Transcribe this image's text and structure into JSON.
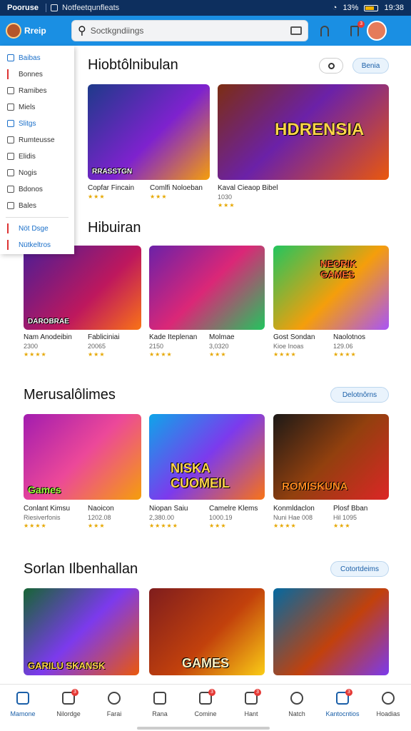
{
  "status": {
    "brand": "Pooruse",
    "notif": "Notfeetqunfleats",
    "battery": "13%",
    "time": "19:38"
  },
  "appbar": {
    "app_name": "Rreip",
    "search_placeholder": "Soctkgndiings"
  },
  "sidebar": {
    "items": [
      {
        "label": "Baibas",
        "style": "blue"
      },
      {
        "label": "Bonnes",
        "style": "mark"
      },
      {
        "label": "Ramibes",
        "style": ""
      },
      {
        "label": "Miels",
        "style": ""
      },
      {
        "label": "Slitgs",
        "style": "blue"
      },
      {
        "label": "Rumteusse",
        "style": ""
      },
      {
        "label": "Elidis",
        "style": ""
      },
      {
        "label": "Nogis",
        "style": ""
      },
      {
        "label": "Bdonos",
        "style": ""
      },
      {
        "label": "Bales",
        "style": ""
      },
      {
        "label": "Nöt Dsge",
        "style": "bluemark"
      },
      {
        "label": "Nütkeltros",
        "style": "bluemark"
      }
    ]
  },
  "sections": [
    {
      "title": "Hiobtôlnibulan",
      "pill": "Benia",
      "cards": [
        {
          "image_text": "RRASSTGN",
          "title": "Copfar Fincain",
          "sub": "",
          "stars": "★★★"
        },
        {
          "image_text": "",
          "title": "Comlfi Noloeban",
          "sub": "",
          "stars": "★★★"
        },
        {
          "image_text": "HDRENSIA",
          "title": "Kaval Cieaop Bibel",
          "sub": "1030",
          "stars": "★★★"
        }
      ]
    },
    {
      "title": "Hibuiran",
      "pill": "",
      "cards": [
        {
          "image_text": "DAROBRAE",
          "title": "Nam Anodeibin",
          "sub": "2300",
          "stars": "★★★★"
        },
        {
          "image_text": "",
          "title": "Fabliciniai",
          "sub": "20065",
          "stars": "★★★"
        },
        {
          "image_text": "",
          "title": "Kade Iteplenan",
          "sub": "2150",
          "stars": "★★★★"
        },
        {
          "image_text": "",
          "title": "Molmae",
          "sub": "3,0320",
          "stars": "★★★"
        },
        {
          "image_text": "NEORIK GAMES",
          "title": "Gost Sondan",
          "sub": "Kioe Inoas",
          "stars": "★★★★"
        },
        {
          "image_text": "",
          "title": "Naolotnos",
          "sub": "129.06",
          "stars": "★★★★"
        }
      ]
    },
    {
      "title": "Merusalôlimes",
      "pill": "Delotnôrns",
      "cards": [
        {
          "image_text": "Games",
          "title": "Conlant Kimsu",
          "sub": "Riesiverfonis",
          "stars": "★★★★"
        },
        {
          "image_text": "",
          "title": "Naoicon",
          "sub": "1202.08",
          "stars": "★★★"
        },
        {
          "image_text": "NISKA CUOMEIL",
          "title": "Niopan Saiu",
          "sub": "2,380.00",
          "stars": "★★★★★"
        },
        {
          "image_text": "",
          "title": "Camelre Klems",
          "sub": "1000.19",
          "stars": "★★★"
        },
        {
          "image_text": "ROMISKUNA",
          "title": "Konmldaclon",
          "sub": "Nuni Hae 008",
          "stars": "★★★★"
        },
        {
          "image_text": "",
          "title": "Plosf Bban",
          "sub": "Hil 1095",
          "stars": "★★★"
        }
      ]
    },
    {
      "title": "Sorlan Ilbenhallan",
      "pill": "Cotortdeims",
      "cards": [
        {
          "image_text": "GARILU SKANSK",
          "title": "",
          "sub": "",
          "stars": ""
        },
        {
          "image_text": "GAMES",
          "title": "",
          "sub": "",
          "stars": ""
        },
        {
          "image_text": "",
          "title": "",
          "sub": "",
          "stars": ""
        }
      ]
    }
  ],
  "bottom_nav": [
    {
      "label": "Mamone",
      "badge": ""
    },
    {
      "label": "Nilordge",
      "badge": "3"
    },
    {
      "label": "Farai",
      "badge": ""
    },
    {
      "label": "Rana",
      "badge": ""
    },
    {
      "label": "Comine",
      "badge": "3"
    },
    {
      "label": "Hant",
      "badge": "3"
    },
    {
      "label": "Natch",
      "badge": ""
    },
    {
      "label": "Kantocntios",
      "badge": "3"
    },
    {
      "label": "Hoadias",
      "badge": ""
    }
  ],
  "colors": {
    "appbar": "#1a8fe3",
    "status": "#0d2f5e",
    "accent": "#1a5fa8",
    "stars": "#e6a700"
  }
}
